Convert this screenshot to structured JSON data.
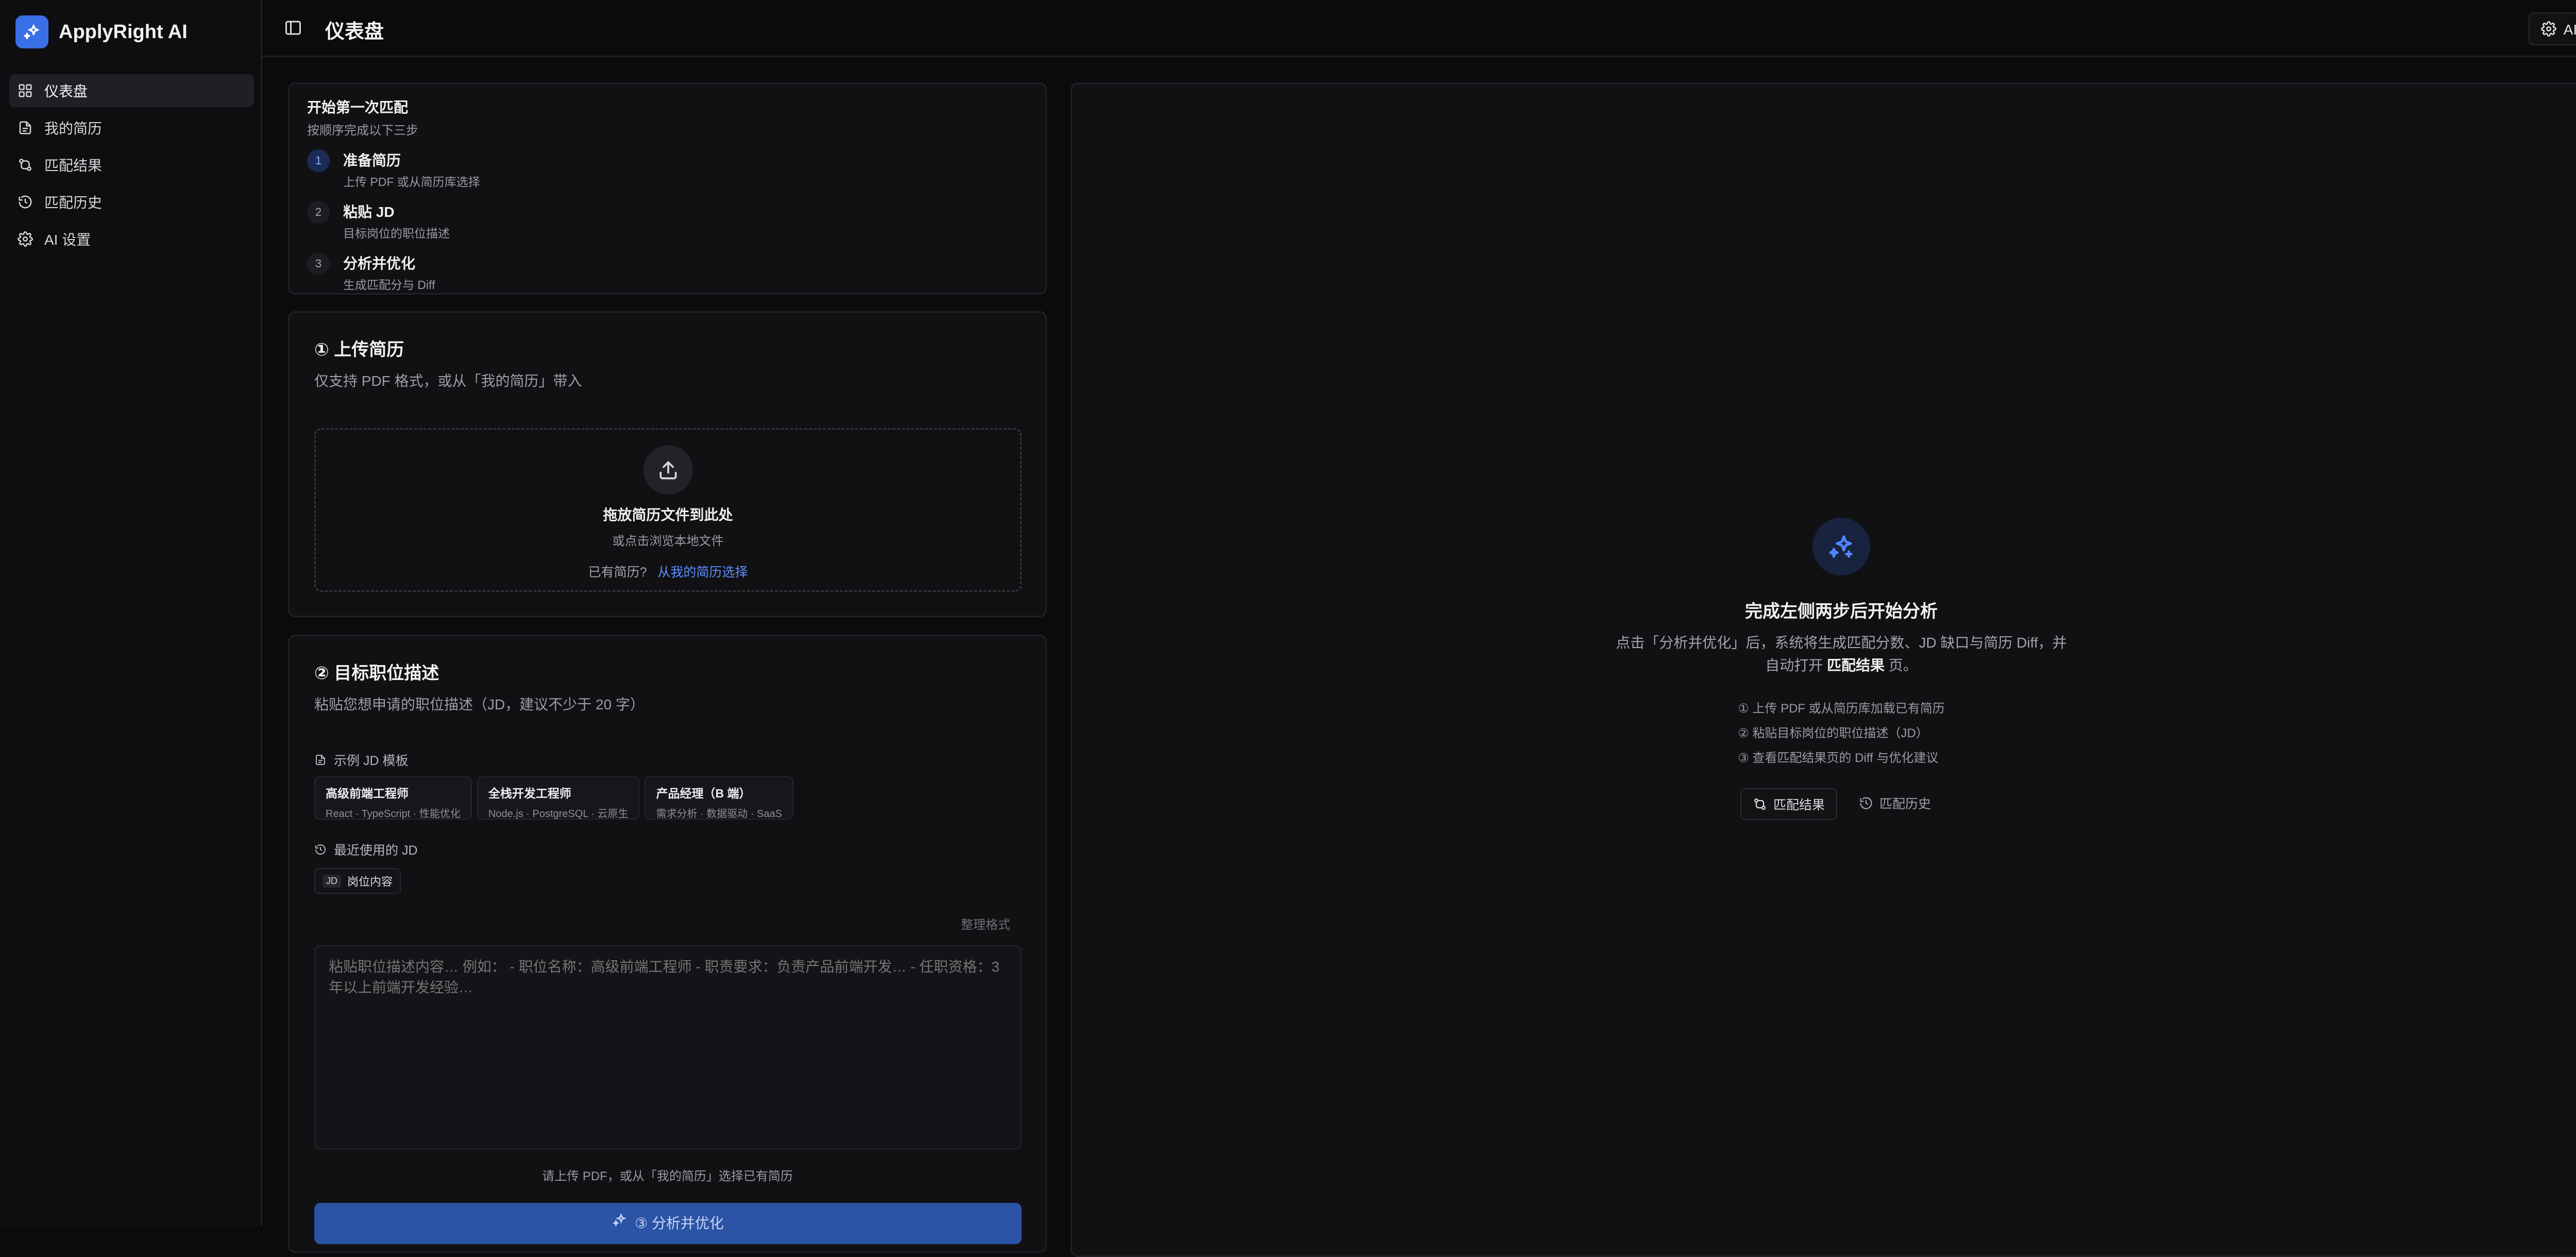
{
  "brand": {
    "name": "ApplyRight AI"
  },
  "sidebar": {
    "items": [
      {
        "label": "仪表盘",
        "icon": "dashboard-icon",
        "active": true
      },
      {
        "label": "我的简历",
        "icon": "file-icon"
      },
      {
        "label": "匹配结果",
        "icon": "compare-icon"
      },
      {
        "label": "匹配历史",
        "icon": "history-icon"
      },
      {
        "label": "AI 设置",
        "icon": "gear-icon"
      }
    ]
  },
  "header": {
    "title": "仪表盘",
    "ai_settings_label": "AI 设置"
  },
  "steps": {
    "title": "开始第一次匹配",
    "subtitle": "按顺序完成以下三步",
    "items": [
      {
        "num": "1",
        "title": "准备简历",
        "desc": "上传 PDF 或从简历库选择"
      },
      {
        "num": "2",
        "title": "粘贴 JD",
        "desc": "目标岗位的职位描述"
      },
      {
        "num": "3",
        "title": "分析并优化",
        "desc": "生成匹配分与 Diff"
      }
    ]
  },
  "upload": {
    "title": "① 上传简历",
    "subtitle": "仅支持 PDF 格式，或从「我的简历」带入",
    "drop_title": "拖放简历文件到此处",
    "drop_sub": "或点击浏览本地文件",
    "alt_text": "已有简历?",
    "alt_link": "从我的简历选择"
  },
  "jd": {
    "title": "② 目标职位描述",
    "subtitle": "粘贴您想申请的职位描述（JD，建议不少于 20 字）",
    "templates_label": "示例 JD 模板",
    "templates": [
      {
        "title": "高级前端工程师",
        "desc": "React · TypeScript · 性能优化"
      },
      {
        "title": "全栈开发工程师",
        "desc": "Node.js · PostgreSQL · 云原生"
      },
      {
        "title": "产品经理（B 端）",
        "desc": "需求分析 · 数据驱动 · SaaS"
      }
    ],
    "recent_label": "最近使用的 JD",
    "recent_tag": "JD",
    "recent_item": "岗位内容",
    "format_label": "整理格式",
    "placeholder": "粘贴职位描述内容… 例如： - 职位名称：高级前端工程师 - 职责要求：负责产品前端开发… - 任职资格：3年以上前端开发经验…",
    "hint": "请上传 PDF，或从「我的简历」选择已有简历",
    "analyze_label": "③ 分析并优化"
  },
  "right": {
    "title": "完成左侧两步后开始分析",
    "desc_before": "点击「分析并优化」后，系统将生成匹配分数、JD 缺口与简历 Diff，并自动打开 ",
    "desc_bold": "匹配结果",
    "desc_after": " 页。",
    "list": [
      "① 上传 PDF 或从简历库加载已有简历",
      "② 粘贴目标岗位的职位描述（JD）",
      "③ 查看匹配结果页的 Diff 与优化建议"
    ],
    "btn_results": "匹配结果",
    "btn_history": "匹配历史"
  },
  "colors": {
    "accent": "#3b6fe6",
    "link": "#5b8dff",
    "primary_button": "#2b53a6"
  }
}
